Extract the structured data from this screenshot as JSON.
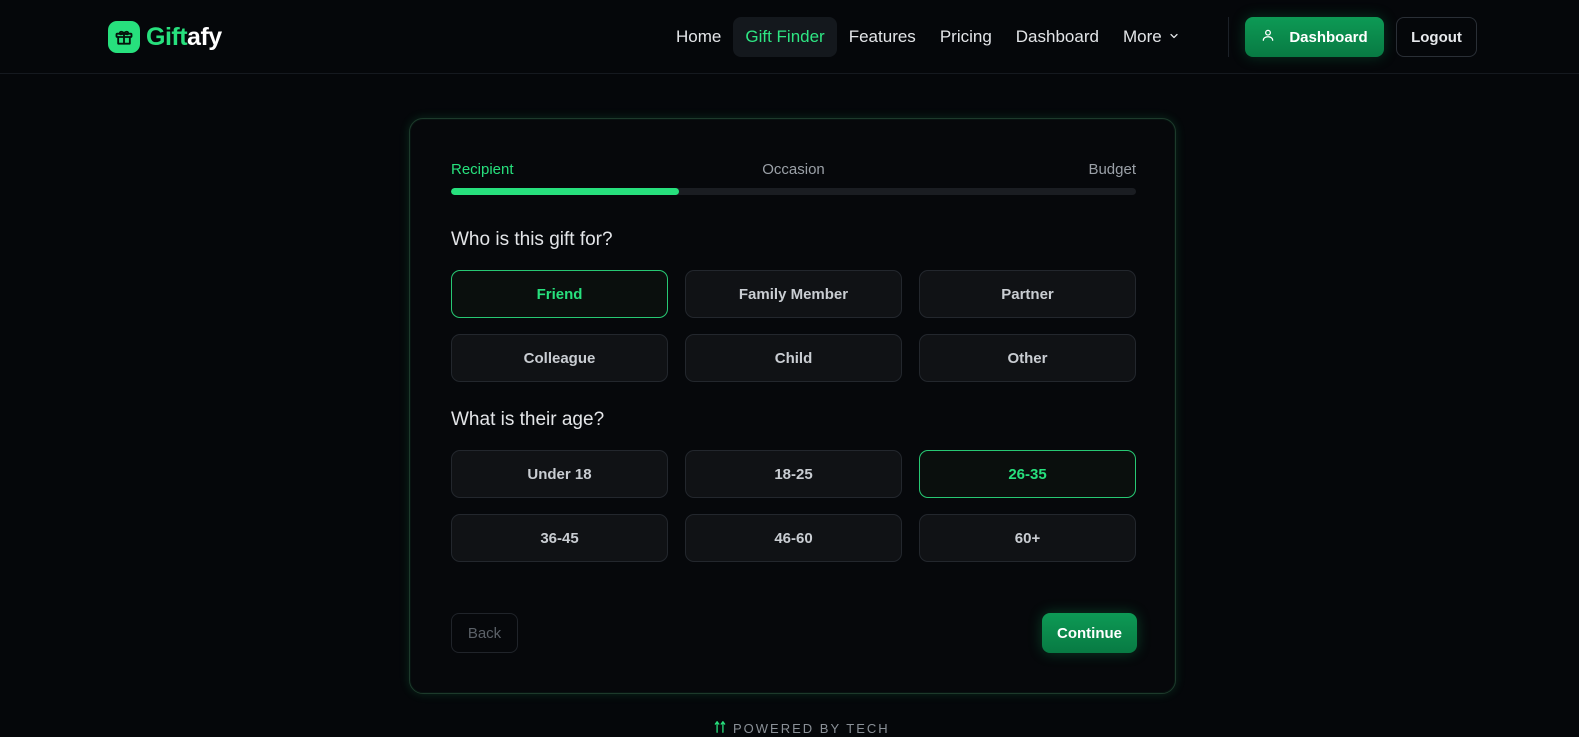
{
  "brand": {
    "name_part1": "Gift",
    "name_part2": "afy",
    "icon": "gift-icon",
    "accent": "#27e07d"
  },
  "nav": {
    "items": [
      {
        "label": "Home"
      },
      {
        "label": "Gift Finder",
        "active": true
      },
      {
        "label": "Features"
      },
      {
        "label": "Pricing"
      },
      {
        "label": "Dashboard"
      },
      {
        "label": "More",
        "icon": "chevron-down-icon"
      }
    ],
    "dashboard_button": "Dashboard",
    "dashboard_icon": "user-icon",
    "logout_button": "Logout"
  },
  "wizard": {
    "steps": [
      "Recipient",
      "Occasion",
      "Budget"
    ],
    "current_step": "Recipient",
    "progress": 0.333,
    "recipient": {
      "question": "Who is this gift for?",
      "options": [
        "Friend",
        "Family Member",
        "Partner",
        "Colleague",
        "Child",
        "Other"
      ],
      "selected": "Friend"
    },
    "age": {
      "question": "What is their age?",
      "options": [
        "Under 18",
        "18-25",
        "26-35",
        "36-45",
        "46-60",
        "60+"
      ],
      "selected": "26-35"
    },
    "back_label": "Back",
    "continue_label": "Continue"
  },
  "footer": {
    "text": "POWERED BY TECH",
    "icon": "sparkle-icon"
  }
}
